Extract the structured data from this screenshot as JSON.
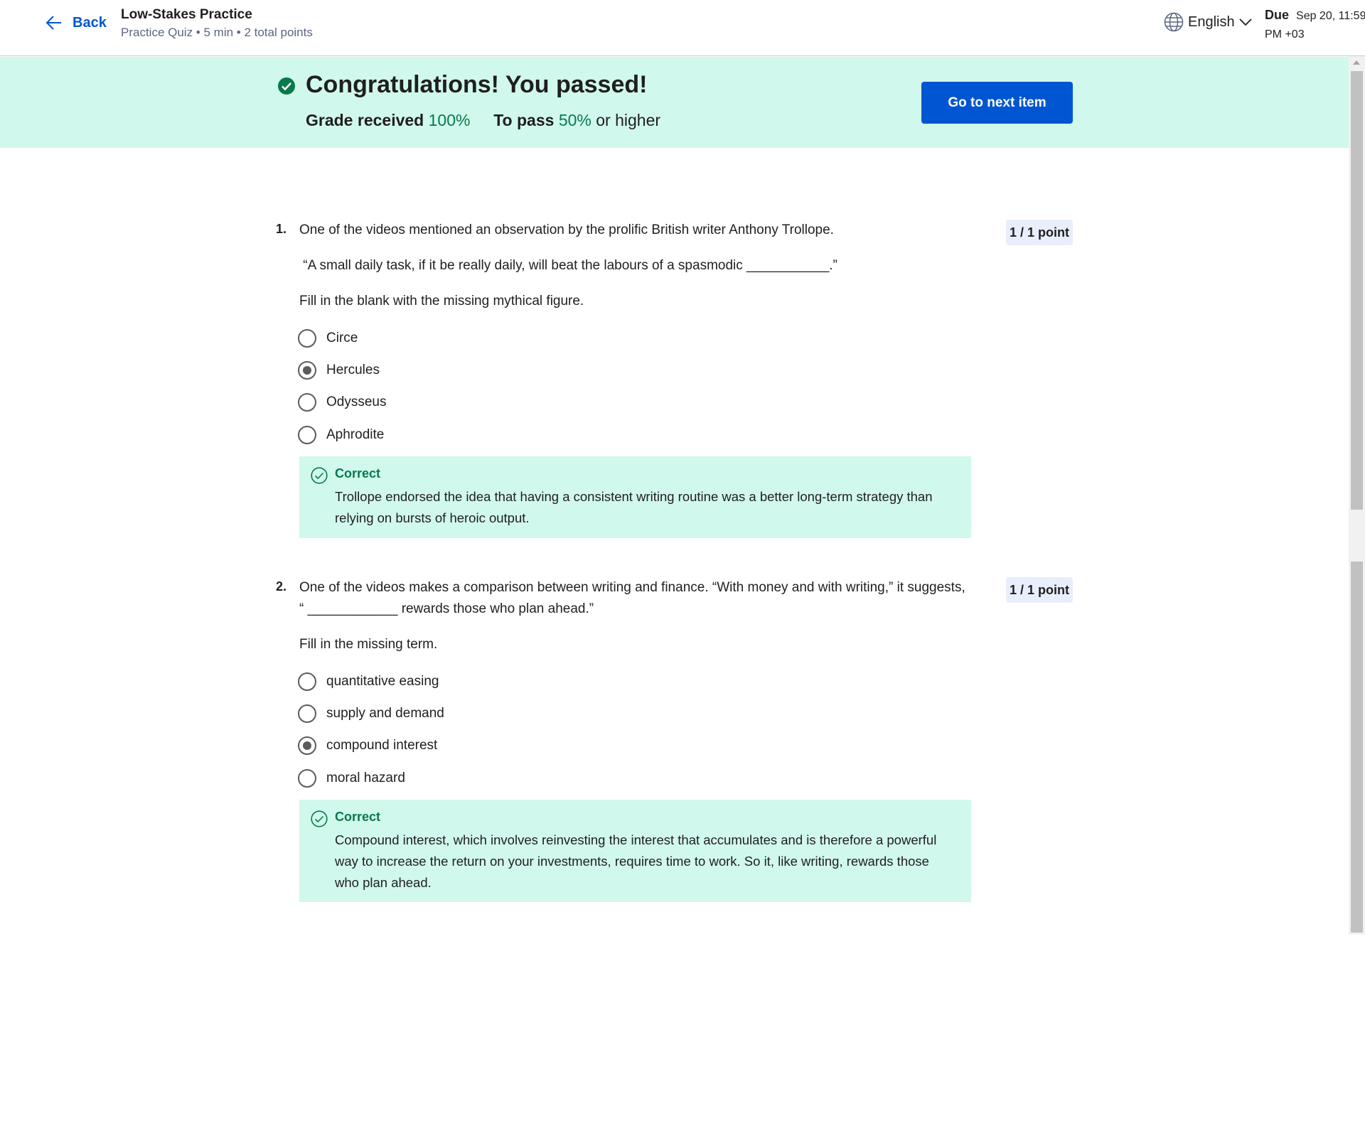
{
  "header": {
    "back_label": "Back",
    "title": "Low-Stakes Practice",
    "subtitle": "Practice Quiz • 5 min • 2 total points",
    "language": "English",
    "due_label": "Due",
    "due_date_line1": "Sep 20, 11:59",
    "due_date_line2": "PM +03"
  },
  "banner": {
    "title": "Congratulations! You passed!",
    "grade_label": "Grade received",
    "grade_value": "100%",
    "pass_label": "To pass",
    "pass_value": "50%",
    "pass_suffix": "or higher",
    "next_button": "Go to next item",
    "accent_color": "#d1f8ec",
    "button_color": "#0056d2"
  },
  "questions": [
    {
      "number": "1.",
      "text": "One of the videos mentioned an observation by the prolific British writer Anthony Trollope.",
      "quote": " “A small daily task, if it be really daily, will beat the labours of a spasmodic ___________.”",
      "instruction": "Fill in the blank with the missing mythical figure.",
      "points": "1 / 1 point",
      "options": [
        {
          "label": "Circe",
          "selected": false
        },
        {
          "label": "Hercules",
          "selected": true
        },
        {
          "label": "Odysseus",
          "selected": false
        },
        {
          "label": "Aphrodite",
          "selected": false
        }
      ],
      "feedback": {
        "status": "Correct",
        "text": "Trollope endorsed the idea that having a consistent writing routine was a better long-term strategy than relying on bursts of heroic output."
      }
    },
    {
      "number": "2.",
      "text": "One of the videos makes a comparison between writing and finance. “With money and with writing,” it suggests, “ ____________ rewards those who plan ahead.”",
      "instruction": "Fill in the missing term.",
      "points": "1 / 1 point",
      "options": [
        {
          "label": "quantitative easing",
          "selected": false
        },
        {
          "label": "supply and demand",
          "selected": false
        },
        {
          "label": "compound interest",
          "selected": true
        },
        {
          "label": "moral hazard",
          "selected": false
        }
      ],
      "feedback": {
        "status": "Correct",
        "text": "Compound interest, which involves reinvesting the interest that accumulates and is therefore a powerful way to increase the return on your investments, requires time to work. So it, like writing, rewards those who plan ahead."
      }
    }
  ]
}
